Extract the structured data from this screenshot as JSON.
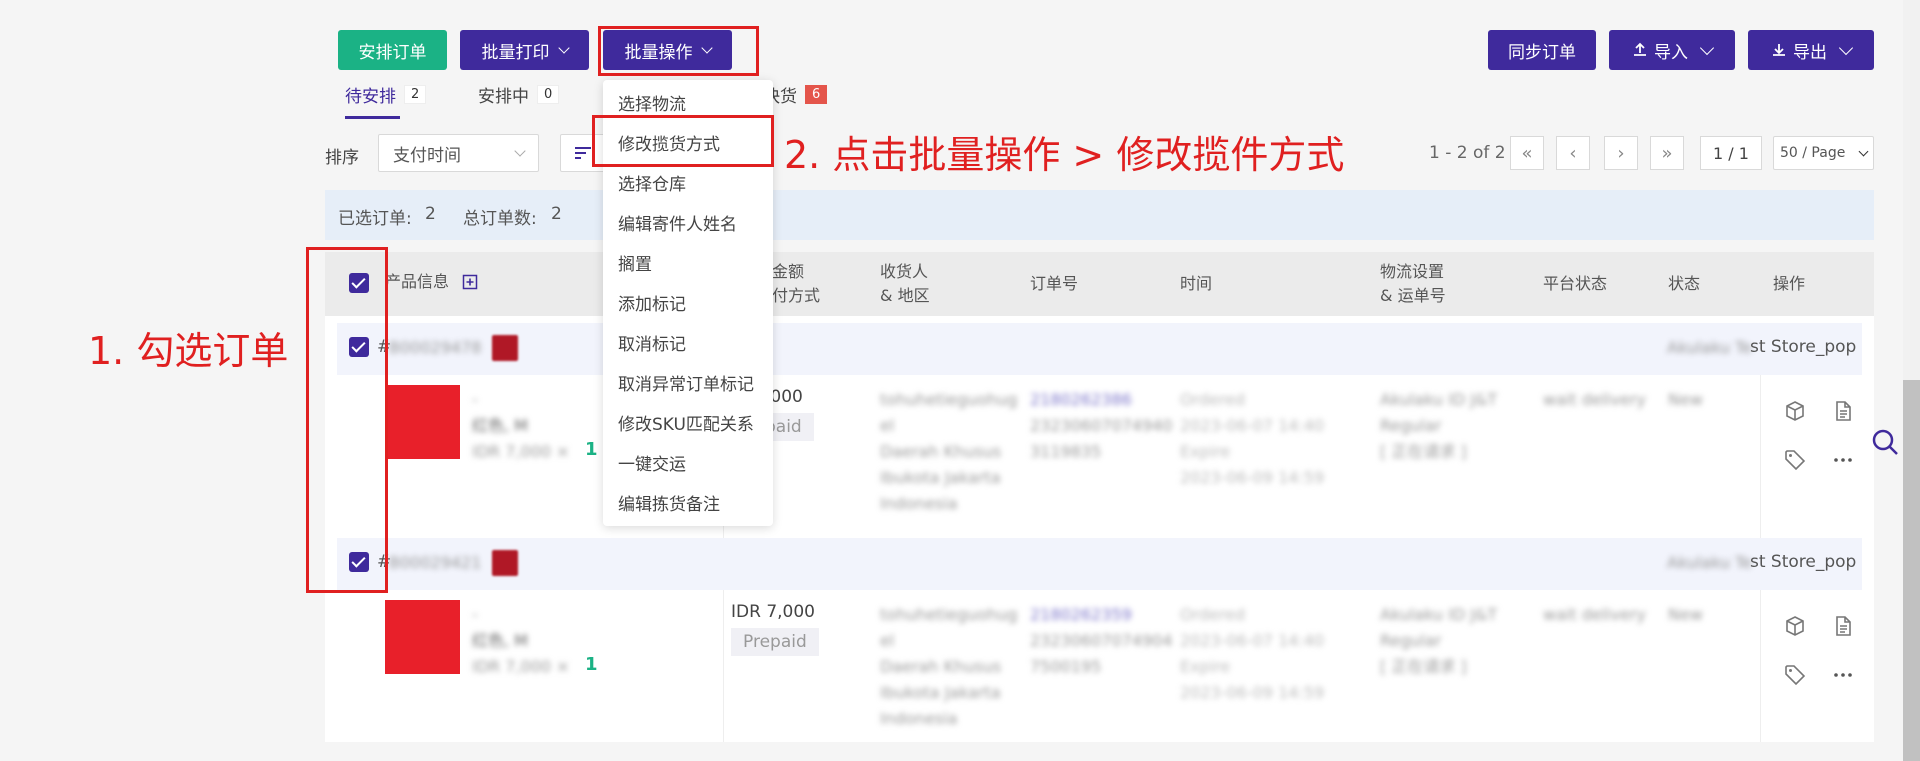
{
  "toolbar": {
    "arrange_label": "安排订单",
    "batch_print_label": "批量打印",
    "batch_ops_label": "批量操作",
    "sync_label": "同步订单",
    "import_label": "导入",
    "export_label": "导出"
  },
  "tabs": [
    {
      "label": "待安排",
      "count": "2"
    },
    {
      "label": "安排中",
      "count": "0"
    },
    {
      "label": "快货",
      "count": "6"
    }
  ],
  "sort": {
    "label": "排序",
    "value": "支付时间"
  },
  "pagination": {
    "range": "1 - 2 of 2",
    "page": "1 / 1",
    "per_page": "50 / Page"
  },
  "info": {
    "selected_label": "已选订单:",
    "selected_count": "2",
    "total_label": "总订单数:",
    "total_count": "2"
  },
  "columns": {
    "product": "产品信息",
    "amount_line1": "金额",
    "amount_line2": "付方式",
    "recipient_line1": "收货人",
    "recipient_line2": "& 地区",
    "order_no": "订单号",
    "time": "时间",
    "logistics_line1": "物流设置",
    "logistics_line2": "& 运单号",
    "platform_status": "平台状态",
    "status": "状态",
    "actions": "操作"
  },
  "orders": [
    {
      "id_prefix": "#",
      "store": "st Store_pop",
      "amount": ",000",
      "pay": "paid",
      "qty": "1",
      "sku_price_blur": "IDR 7,000",
      "variant_blur": "红色, M"
    },
    {
      "id_prefix": "#",
      "store": "st Store_pop",
      "amount": "IDR 7,000",
      "pay": "Prepaid",
      "qty": "1",
      "sku_price_blur": "IDR 7,000",
      "variant_blur": "红色, M"
    }
  ],
  "dropdown": [
    "选择物流",
    "修改揽货方式",
    "选择仓库",
    "编辑寄件人姓名",
    "搁置",
    "添加标记",
    "取消标记",
    "取消异常订单标记",
    "修改SKU匹配关系",
    "一键交运",
    "编辑拣货备注"
  ],
  "annotations": {
    "step1": "1. 勾选订单",
    "step2": "2. 点击批量操作 > 修改揽件方式"
  },
  "colors": {
    "accent": "#3f2a9c",
    "green": "#1bb285",
    "annotation": "#e02020"
  }
}
